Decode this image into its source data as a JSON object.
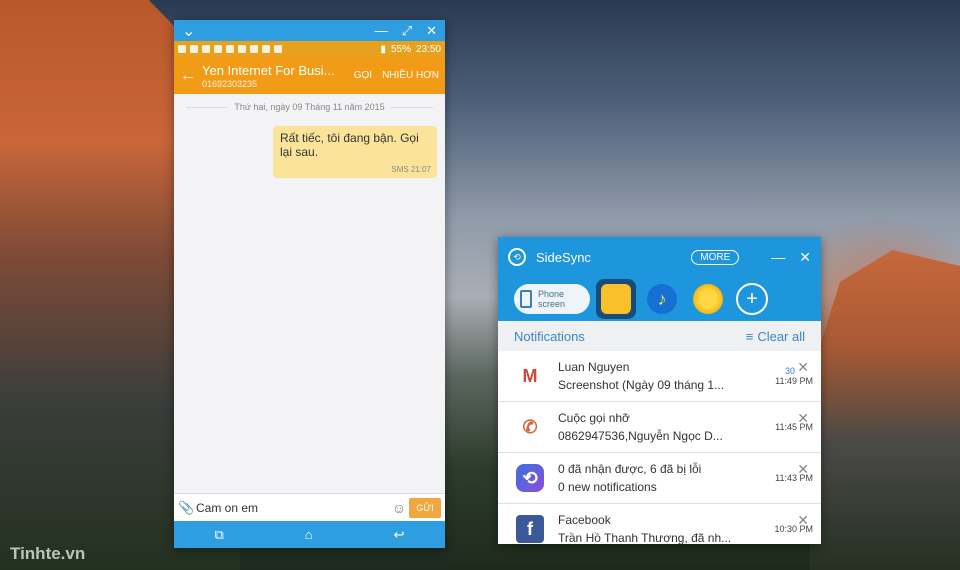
{
  "phone": {
    "statusbar": {
      "battery": "55%",
      "time": "23:50"
    },
    "appbar": {
      "title": "Yen Internet For Busi...",
      "subtitle": "01692303235",
      "call_label": "GỌI",
      "more_label": "NHIỀU HƠN"
    },
    "date_divider": "Thứ hai, ngày 09 Tháng 11 năm 2015",
    "message": {
      "text": "Rất tiếc, tôi đang bận. Gọi lại sau.",
      "meta": "SMS 21:07"
    },
    "composer": {
      "value": "Cam on em",
      "send_label": "GỬI"
    }
  },
  "sidesync": {
    "title": "SideSync",
    "more_label": "MORE",
    "phone_screen_label_1": "Phone",
    "phone_screen_label_2": "screen",
    "notifications_label": "Notifications",
    "clear_all_label": "Clear all",
    "items": [
      {
        "icon": "gmail-icon",
        "name": "Luan Nguyen",
        "body": "Screenshot (Ngày 09 tháng 1...",
        "count": "30",
        "time": "11:49 PM"
      },
      {
        "icon": "missed-call-icon",
        "name": "Cuộc gọi nhỡ",
        "body": "0862947536,Nguyễn Ngọc D...",
        "count": "",
        "time": "11:45 PM"
      },
      {
        "icon": "sidesync-icon",
        "name": "0 đã nhận được, 6 đã bị lỗi",
        "body": "0 new notifications",
        "count": "",
        "time": "11:43 PM"
      },
      {
        "icon": "facebook-icon",
        "name": "Facebook",
        "body": "Trần Hồ Thanh Thương, đã nh...",
        "count": "",
        "time": "10:30 PM"
      }
    ]
  },
  "watermark": "Tinhte.vn"
}
